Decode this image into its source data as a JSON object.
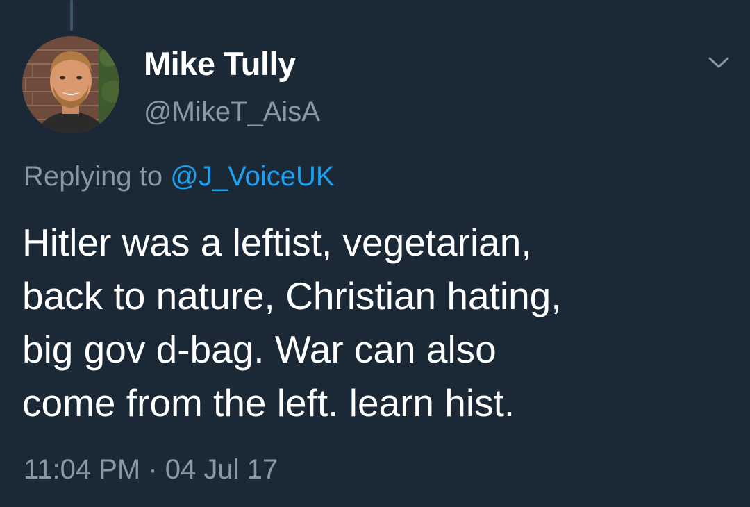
{
  "tweet": {
    "author": {
      "display_name": "Mike Tully",
      "handle": "@MikeT_AisA",
      "avatar_icon": "profile-photo"
    },
    "replying_to_label": "Replying to",
    "replying_to_handle": "@J_VoiceUK",
    "text": "Hitler was a leftist,  vegetarian,\nback to nature, Christian hating,\nbig gov d-bag. War can also\ncome from the left. learn hist.",
    "timestamp": "11:04 PM · 04 Jul 17",
    "menu_icon": "chevron-down-icon"
  },
  "colors": {
    "background": "#1b2836",
    "primary_text": "#ffffff",
    "secondary_text": "#8899a6",
    "link": "#1da1f2",
    "thread_line": "#3d5466"
  }
}
